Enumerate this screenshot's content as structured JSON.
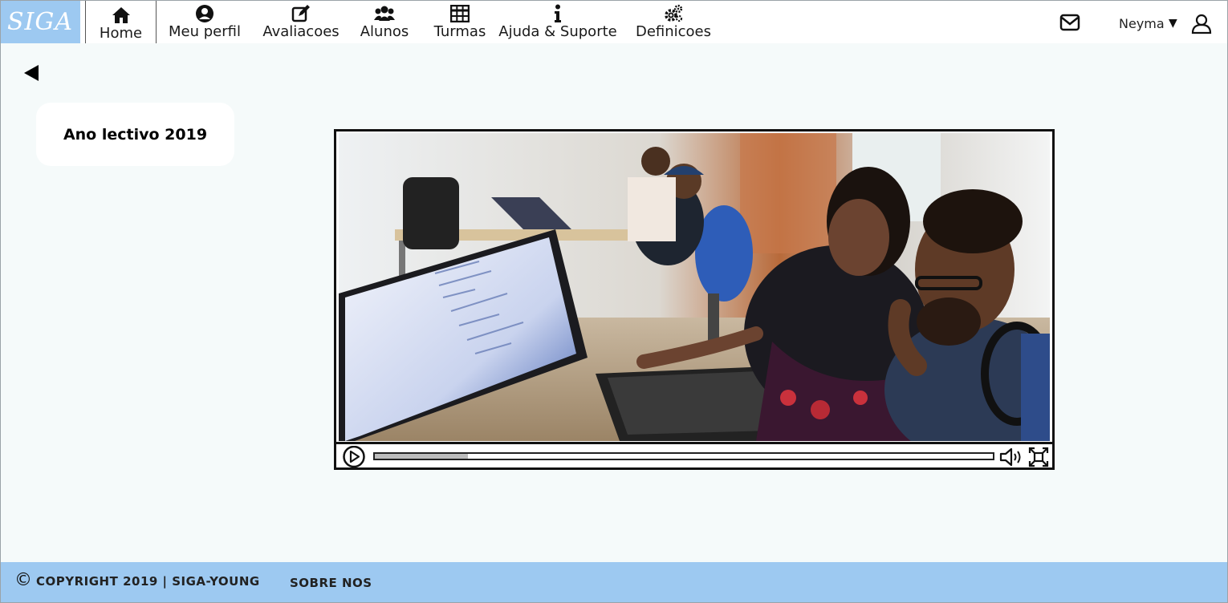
{
  "app": {
    "logo_text": "SIGA"
  },
  "nav": {
    "home": "Home",
    "profile": "Meu perfil",
    "evaluations": "Avaliacoes",
    "students": "Alunos",
    "classes": "Turmas",
    "help": "Ajuda & Suporte",
    "settings": "Definicoes"
  },
  "user": {
    "name": "Neyma",
    "caret": "▼"
  },
  "icons": {
    "home": "home-icon",
    "profile": "user-circle-icon",
    "evaluations": "edit-icon",
    "students": "users-icon",
    "classes": "table-icon",
    "help": "info-icon",
    "settings": "gears-icon",
    "mail": "mail-icon",
    "user": "user-outline-icon",
    "back": "back-arrow-icon",
    "play": "play-icon",
    "volume": "volume-icon",
    "fullscreen": "fullscreen-icon",
    "copyright": "copyright-icon"
  },
  "main": {
    "year_card": "Ano lectivo 2019",
    "video": {
      "progress": 0.15
    }
  },
  "footer": {
    "copyright_symbol": "©",
    "copyright": "COPYRIGHT 2019 | SIGA-YOUNG",
    "about": "SOBRE NOS"
  },
  "colors": {
    "accent": "#9dc9f1",
    "page_bg": "#f5fafa",
    "header_bg": "#ffffff"
  }
}
